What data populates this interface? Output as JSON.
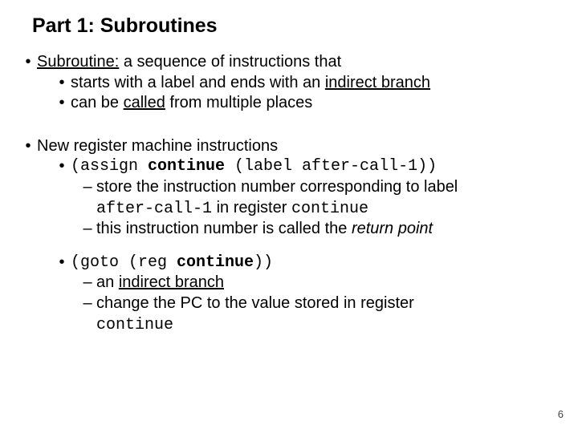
{
  "title": "Part 1: Subroutines",
  "b1": {
    "term": "Subroutine:",
    "rest": " a sequence of instructions that"
  },
  "b1a": {
    "pre": "starts with a label and ends with an ",
    "under": "indirect branch"
  },
  "b1b": {
    "pre": "can be ",
    "under": "called",
    "post": " from multiple places"
  },
  "b2": "New register machine instructions",
  "b2a": {
    "open": "(assign ",
    "kw": "continue",
    "rest": " (label after-call-1))"
  },
  "b2a1": {
    "l1": "store the instruction number corresponding to label",
    "code": "after-call-1",
    "mid": " in register ",
    "code2": "continue"
  },
  "b2a2": {
    "pre": "this instruction number is called the ",
    "em": "return point"
  },
  "b2b": {
    "open": "(goto (reg ",
    "kw": "continue",
    "close": "))"
  },
  "b2b1": {
    "pre": "an ",
    "under": "indirect branch"
  },
  "b2b2": {
    "l1": "change the PC to the value stored in register",
    "code": "continue"
  },
  "page": "6"
}
